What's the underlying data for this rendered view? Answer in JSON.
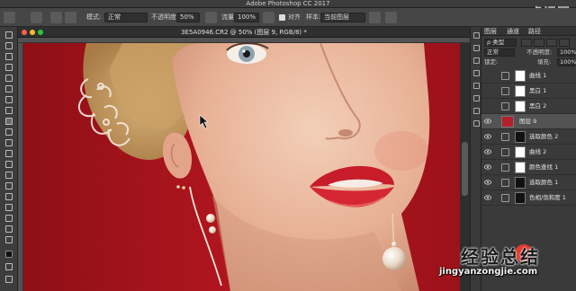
{
  "app": {
    "title": "Adobe Photoshop CC 2017"
  },
  "watermark": {
    "top": "虎课网",
    "brand_cn": "经验总结",
    "brand_url": "jingyanzongjie.com"
  },
  "options_bar": {
    "mode_label": "模式:",
    "mode_value": "正常",
    "opacity_label": "不透明度:",
    "opacity_value": "50%",
    "flow_label": "流量:",
    "flow_value": "100%",
    "align_label": "对齐",
    "sample_label": "样本:",
    "sample_value": "当前图层"
  },
  "document": {
    "tab_title": "3E5A0946.CR2 @ 50% (图层 9, RGB/8) *"
  },
  "layers_panel": {
    "tabs": [
      "图层",
      "通道",
      "路径"
    ],
    "kind_filter": "ρ 类型",
    "blend_mode": "正常",
    "opacity_label": "不透明度:",
    "opacity_value": "100%",
    "lock_label": "锁定:",
    "fill_label": "填充:",
    "fill_value": "100%",
    "layers": [
      {
        "name": "曲线 1",
        "type": "adjustment",
        "mask": "white",
        "visible": false
      },
      {
        "name": "黑白 1",
        "type": "adjustment",
        "mask": "white",
        "visible": false
      },
      {
        "name": "黑白 2",
        "type": "adjustment",
        "mask": "white",
        "visible": false
      },
      {
        "name": "图层 9",
        "type": "pixel",
        "selected": true,
        "visible": true
      },
      {
        "name": "选取颜色 2",
        "type": "adjustment",
        "mask": "black-figure",
        "visible": true
      },
      {
        "name": "曲线 2",
        "type": "adjustment",
        "mask": "white",
        "visible": true
      },
      {
        "name": "颜色查找 1",
        "type": "adjustment",
        "mask": "white",
        "visible": true
      },
      {
        "name": "选取颜色 1",
        "type": "adjustment",
        "mask": "black-figure",
        "visible": true
      },
      {
        "name": "色相/饱和度 1",
        "type": "adjustment",
        "mask": "black-figure",
        "visible": true
      }
    ]
  },
  "colors": {
    "canvas_bg": "#a8141c",
    "ui_dark": "#3a3a3a",
    "selected_layer": "#535353"
  }
}
